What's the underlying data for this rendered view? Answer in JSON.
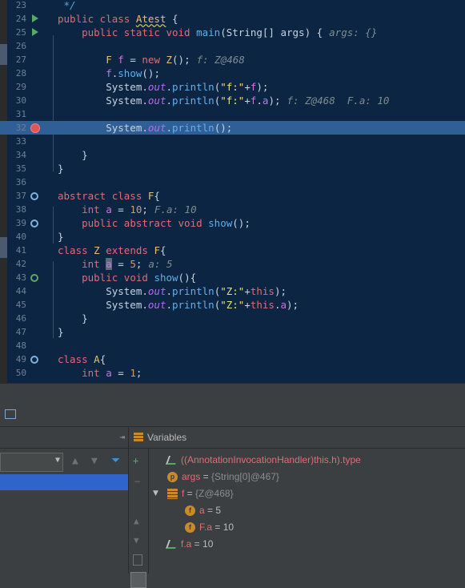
{
  "editor": {
    "lines": [
      {
        "n": "23",
        "html": "<span class='cmt'> */</span>"
      },
      {
        "n": "24",
        "html": "<span class='kw'>public class</span> <span class='cls squig'>Atest</span> {"
      },
      {
        "n": "25",
        "html": "    <span class='kw'>public static void</span> <span class='method'>main</span>(String[] args) {<span class='hint'>args: {}</span>"
      },
      {
        "n": "26",
        "html": ""
      },
      {
        "n": "27",
        "html": "        <span class='cls'>F</span> <span class='var'>f</span> = <span class='kw'>new</span> <span class='cls'>Z</span>();<span class='hint'>f: Z@468</span>"
      },
      {
        "n": "28",
        "html": "        <span class='var'>f</span>.<span class='method'>show</span>();"
      },
      {
        "n": "29",
        "html": "        System.<span class='fld'>out</span>.<span class='method'>println</span>(<span class='str'>\"f:\"</span>+<span class='var'>f</span>);"
      },
      {
        "n": "30",
        "html": "        System.<span class='fld'>out</span>.<span class='method'>println</span>(<span class='str'>\"f:\"</span>+<span class='var'>f</span>.<span class='var'>a</span>);<span class='hint'>f: Z@468  F.a: 10</span>"
      },
      {
        "n": "31",
        "html": ""
      },
      {
        "n": "32",
        "html": "        System.<span class='fld'>out</span>.<span class='method'>println</span>();"
      },
      {
        "n": "33",
        "html": ""
      },
      {
        "n": "34",
        "html": "    }"
      },
      {
        "n": "35",
        "html": "}"
      },
      {
        "n": "36",
        "html": ""
      },
      {
        "n": "37",
        "html": "<span class='kw'>abstract class</span> <span class='cls'>F</span>{"
      },
      {
        "n": "38",
        "html": "    <span class='kw'>int</span> <span class='var'>a</span> = <span class='num'>10</span>;<span class='hint'>F.a: 10</span>"
      },
      {
        "n": "39",
        "html": "    <span class='kw'>public abstract void</span> <span class='method'>show</span>();"
      },
      {
        "n": "40",
        "html": "}"
      },
      {
        "n": "41",
        "html": "<span class='kw'>class</span> <span class='cls'>Z</span> <span class='kw'>extends</span> <span class='cls'>F</span>{"
      },
      {
        "n": "42",
        "html": "    <span class='kw'>int</span> <span class='caret'><span class='var'>a</span></span> = <span class='num'>5</span>;<span class='hint'>a: 5</span>"
      },
      {
        "n": "43",
        "html": "    <span class='kw'>public void</span> <span class='method'>show</span>(){"
      },
      {
        "n": "44",
        "html": "        System.<span class='fld'>out</span>.<span class='method'>println</span>(<span class='str'>\"Z:\"</span>+<span class='kw'>this</span>);"
      },
      {
        "n": "45",
        "html": "        System.<span class='fld'>out</span>.<span class='method'>println</span>(<span class='str'>\"Z:\"</span>+<span class='kw'>this</span>.<span class='var'>a</span>);"
      },
      {
        "n": "46",
        "html": "    }"
      },
      {
        "n": "47",
        "html": "}"
      },
      {
        "n": "48",
        "html": ""
      },
      {
        "n": "49",
        "html": "<span class='kw'>class</span> <span class='cls'>A</span>{"
      },
      {
        "n": "50",
        "html": "    <span class='kw'>int</span> <span class='var'>a</span> = <span class='num'>1</span>;"
      }
    ],
    "current_line": "32"
  },
  "variables_panel": {
    "title": "Variables",
    "items": [
      {
        "name": "((AnnotationInvocationHandler)this.h).type",
        "eq": "",
        "value": "",
        "icon": "watch-icon"
      },
      {
        "name": "args",
        "eq": " = ",
        "value": "{String[0]@467}",
        "icon": "param-icon"
      },
      {
        "name": "f",
        "eq": " = ",
        "value": "{Z@468}",
        "icon": "field-list-icon"
      },
      {
        "name": "a",
        "eq": " = ",
        "value": "5",
        "icon": "field-icon"
      },
      {
        "name": "F.a",
        "eq": " = ",
        "value": "10",
        "icon": "field-icon"
      },
      {
        "name": "f.a",
        "eq": " = ",
        "value": "10",
        "icon": "watch-icon"
      }
    ]
  },
  "colors": {
    "editor_bg": "#0b2543",
    "current_line": "#2f5f95",
    "panel_bg": "#3c3f41",
    "accent": "#4a88c7"
  }
}
